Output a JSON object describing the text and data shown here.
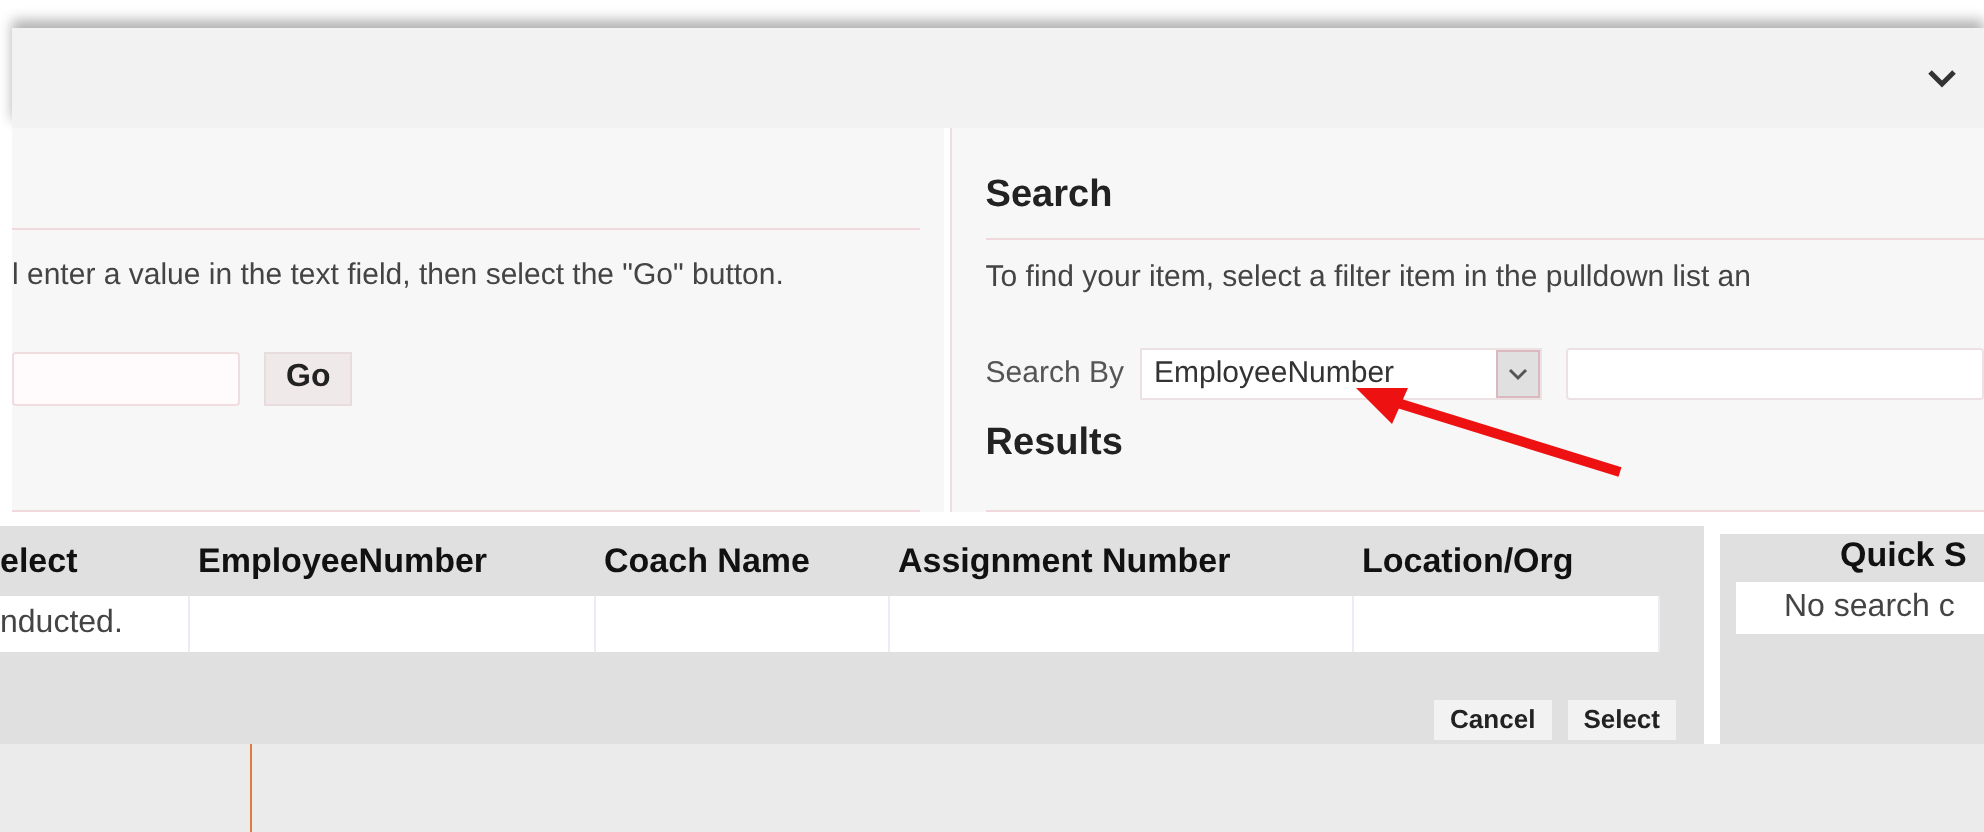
{
  "left_panel": {
    "instruction": "l enter a value in the text field, then select the \"Go\" button.",
    "go_button": "Go"
  },
  "search_panel": {
    "title": "Search",
    "instruction": "To find your item, select a filter item in the pulldown list an",
    "search_by_label": "Search By",
    "search_by_value": "EmployeeNumber",
    "results_title": "Results"
  },
  "table": {
    "columns": [
      "elect",
      "EmployeeNumber",
      "Coach Name",
      "Assignment Number",
      "Location/Org"
    ],
    "rows": [
      [
        "nducted.",
        "",
        "",
        "",
        ""
      ]
    ]
  },
  "quick_search": {
    "title": "Quick S",
    "message": "No search c"
  },
  "buttons": [
    "Cancel",
    "Select"
  ]
}
